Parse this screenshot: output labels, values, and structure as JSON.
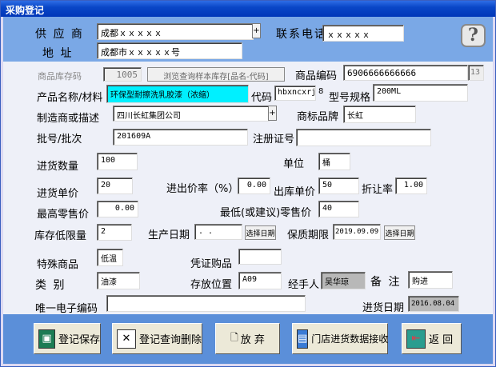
{
  "window": {
    "title": "采购登记"
  },
  "header": {
    "supplier_label": "供 应 商",
    "supplier_value": "成都ｘｘｘｘｘ",
    "phone_label": "联系电话",
    "phone_value": "ｘｘｘｘｘ",
    "address_label": "地  址",
    "address_value": "成都市ｘｘｘｘｘ号",
    "help_glyph": "?"
  },
  "form": {
    "stock_code_label": "商品库存码",
    "stock_code_value": "1005",
    "browse_button": "浏览查询样本库存[品名-代码]",
    "product_code_label": "商品编码",
    "product_code_value": "6906666666666",
    "product_code_len": "13",
    "product_name_label": "产品名称/材料",
    "product_name_value": "环保型耐擦洗乳胶漆（浓缩）",
    "code_label": "代码",
    "code_value": "hbxncxrj",
    "code_len": "8",
    "spec_label": "型号规格",
    "spec_value": "200ML",
    "manufacturer_label": "制造商或描述",
    "manufacturer_value": "四川长虹集团公司",
    "brand_label": "商标品牌",
    "brand_value": "长虹",
    "batch_label": "批号/批次",
    "batch_value": "201609A",
    "reg_no_label": "注册证号",
    "reg_no_value": "",
    "qty_label": "进货数量",
    "qty_value": "100",
    "unit_label": "单位",
    "unit_value": "桶",
    "in_price_label": "进货单价",
    "in_price_value": "20",
    "markup_label": "进出价率（%）",
    "markup_value": "0.00",
    "out_price_label": "出库单价",
    "out_price_value": "50",
    "discount_label": "折让率",
    "discount_value": "1.00",
    "max_retail_label": "最高零售价",
    "max_retail_value": "0.00",
    "min_retail_label": "最低(或建议)零售价",
    "min_retail_value": "40",
    "low_stock_label": "库存低限量",
    "low_stock_value": "2",
    "prod_date_label": "生产日期",
    "prod_date_value": "  .  .",
    "select_date_button": "选择日期",
    "expiry_label": "保质期限",
    "expiry_value": "2019.09.09",
    "select_date_button2": "选择日期",
    "special_label": "特殊商品",
    "special_value": "低温",
    "voucher_label": "凭证购品",
    "voucher_value": "",
    "category_label": "类  别",
    "category_value": "油漆",
    "location_label": "存放位置",
    "location_value": "A09",
    "handler_label": "经手人",
    "handler_value": "吴华琼",
    "remark_label": "备  注",
    "remark_value": "购进",
    "ecode_label": "唯一电子编码",
    "ecode_value": "",
    "in_date_label": "进货日期",
    "in_date_value": "2016.08.04"
  },
  "buttons": {
    "save": "登记保存",
    "query_delete": "登记查询删除",
    "discard": "放 弃",
    "receive": "门店进货数据接收",
    "back": "返 回"
  },
  "icons": {
    "save": "floppy-disk-icon",
    "query_delete": "delete-x-icon",
    "discard": "document-icon",
    "receive": "network-computer-icon",
    "back": "exit-door-icon"
  }
}
